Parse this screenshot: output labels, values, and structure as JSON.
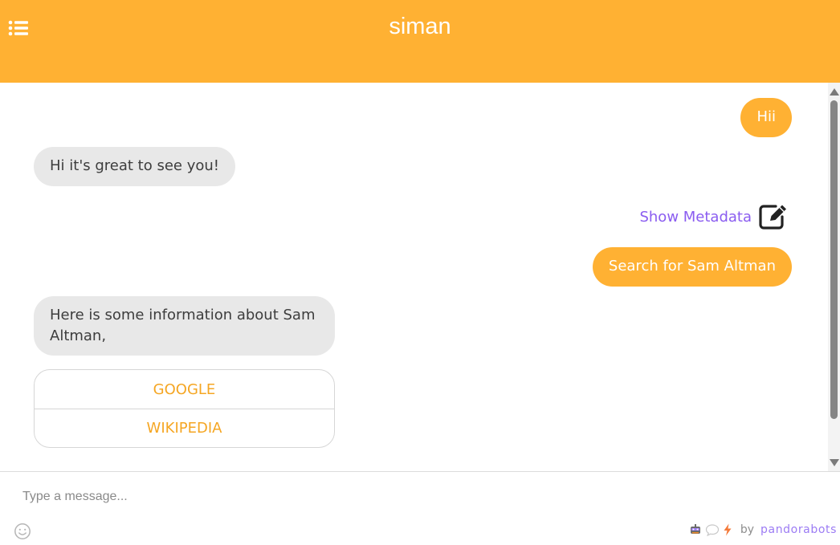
{
  "header": {
    "title": "siman",
    "menu_icon": "list-menu-icon",
    "background_color": "#ffb133"
  },
  "messages": [
    {
      "role": "user",
      "text": "Hii"
    },
    {
      "role": "bot",
      "text": "Hi it's great to see you!"
    },
    {
      "role": "user",
      "text": "Search for Sam Altman"
    },
    {
      "role": "bot",
      "text": "Here is some information about Sam Altman,"
    }
  ],
  "metadata": {
    "label": "Show Metadata",
    "icon": "edit-icon"
  },
  "link_buttons": [
    {
      "label": "GOOGLE"
    },
    {
      "label": "WIKIPEDIA"
    }
  ],
  "composer": {
    "placeholder": "Type a message...",
    "emoji_icon": "smiley-icon"
  },
  "branding": {
    "by": "by",
    "brand": "pandorabots"
  },
  "colors": {
    "accent": "#ffb133",
    "bot_bubble": "#e8e8e8",
    "link_text": "#f5a623",
    "metadata_text": "#8a5cf0",
    "brand_text": "#9c7cf4"
  }
}
